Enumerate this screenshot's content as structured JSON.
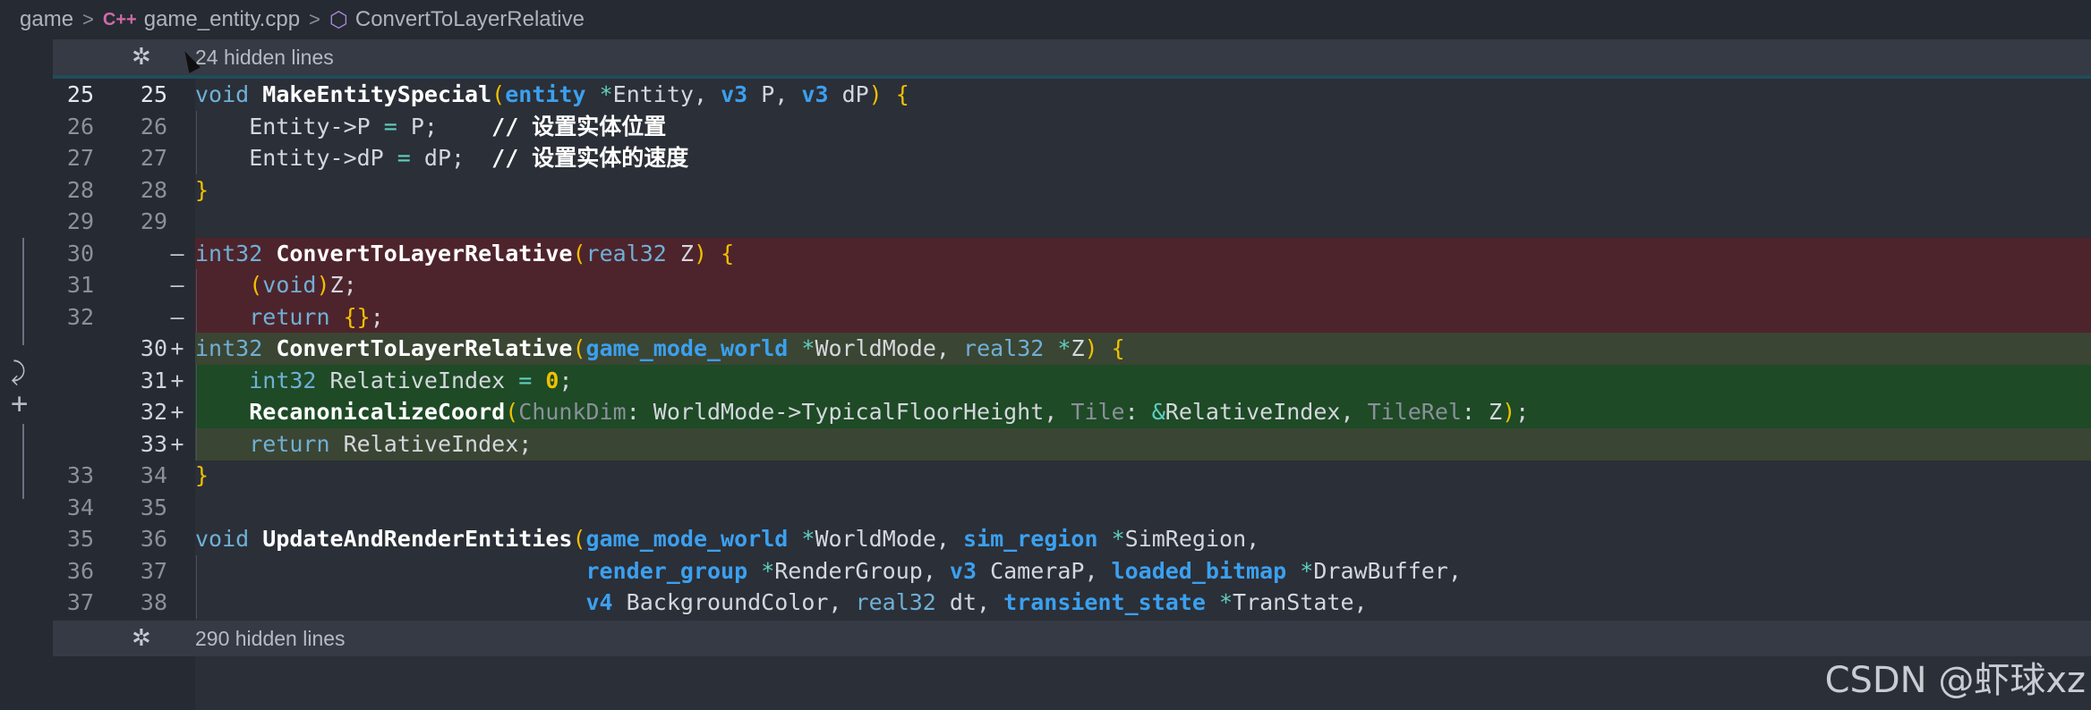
{
  "breadcrumb": {
    "root": "game",
    "file_icon": "C++",
    "file": "game_entity.cpp",
    "symbol": "ConvertToLayerRelative"
  },
  "folds": {
    "top": "24 hidden lines",
    "bottom": "290 hidden lines"
  },
  "lines": [
    {
      "old": "25",
      "new": "25",
      "marker": "",
      "code": "void MakeEntitySpecial(entity *Entity, v3 P, v3 dP) {"
    },
    {
      "old": "26",
      "new": "26",
      "marker": "",
      "code": "    Entity->P = P;    // 设置实体位置"
    },
    {
      "old": "27",
      "new": "27",
      "marker": "",
      "code": "    Entity->dP = dP;  // 设置实体的速度"
    },
    {
      "old": "28",
      "new": "28",
      "marker": "",
      "code": "}"
    },
    {
      "old": "29",
      "new": "29",
      "marker": "",
      "code": ""
    },
    {
      "old": "30",
      "new": "",
      "marker": "—",
      "code": "int32 ConvertToLayerRelative(real32 Z) {"
    },
    {
      "old": "31",
      "new": "",
      "marker": "—",
      "code": "    (void)Z;"
    },
    {
      "old": "32",
      "new": "",
      "marker": "—",
      "code": "    return {};"
    },
    {
      "old": "",
      "new": "30",
      "marker": "+",
      "code": "int32 ConvertToLayerRelative(game_mode_world *WorldMode, real32 *Z) {"
    },
    {
      "old": "",
      "new": "31",
      "marker": "+",
      "code": "    int32 RelativeIndex = 0;"
    },
    {
      "old": "",
      "new": "32",
      "marker": "+",
      "code": "    RecanonicalizeCoord(ChunkDim: WorldMode->TypicalFloorHeight, Tile: &RelativeIndex, TileRel: Z);"
    },
    {
      "old": "",
      "new": "33",
      "marker": "+",
      "code": "    return RelativeIndex;"
    },
    {
      "old": "33",
      "new": "34",
      "marker": "",
      "code": "}"
    },
    {
      "old": "34",
      "new": "35",
      "marker": "",
      "code": ""
    },
    {
      "old": "35",
      "new": "36",
      "marker": "",
      "code": "void UpdateAndRenderEntities(game_mode_world *WorldMode, sim_region *SimRegion,"
    },
    {
      "old": "36",
      "new": "37",
      "marker": "",
      "code": "                             render_group *RenderGroup, v3 CameraP, loaded_bitmap *DrawBuffer,"
    },
    {
      "old": "37",
      "new": "38",
      "marker": "",
      "code": "                             v4 BackgroundColor, real32 dt, transient_state *TranState,"
    }
  ],
  "watermark": "CSDN @虾球xz",
  "colors": {
    "background": "#2b2f37",
    "deleted": "#4e242c",
    "added": "#1e4a26",
    "keyword": "#3ba0f0",
    "function": "#ffffff",
    "brace": "#f0c000"
  },
  "icons": {
    "fold": "snowflake-icon",
    "file": "cpp-file-icon",
    "symbol": "cube-icon"
  }
}
